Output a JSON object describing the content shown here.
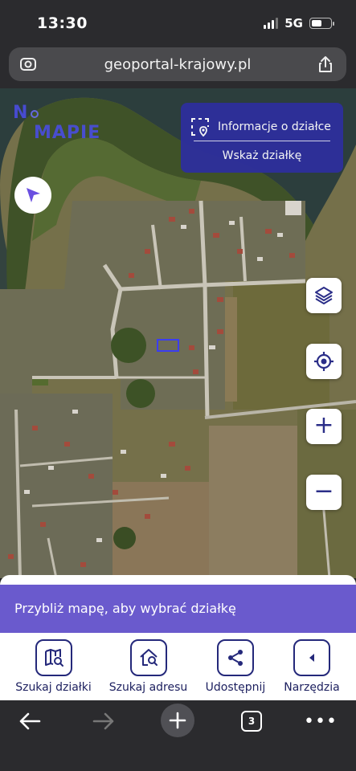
{
  "status_bar": {
    "time": "13:30",
    "network": "5G"
  },
  "browser": {
    "url": "geoportal-krajowy.pl",
    "tab_count": "3"
  },
  "map": {
    "logo": {
      "part1": "N",
      "part2": "MAPIE"
    },
    "parcel_panel": {
      "title": "Informacje o działce",
      "action": "Wskaż działkę"
    }
  },
  "hint": "Przybliż mapę, aby wybrać działkę",
  "toolbar": [
    {
      "label": "Szukaj działki",
      "icon": "map-search-icon"
    },
    {
      "label": "Szukaj adresu",
      "icon": "home-search-icon"
    },
    {
      "label": "Udostępnij",
      "icon": "share-icon"
    },
    {
      "label": "Narzędzia",
      "icon": "tools-icon"
    }
  ],
  "colors": {
    "brand": "#2e2f9c",
    "hint_bg": "#6a5acd",
    "icon_dark": "#24287a",
    "browser_chrome": "#2b2b2e"
  }
}
